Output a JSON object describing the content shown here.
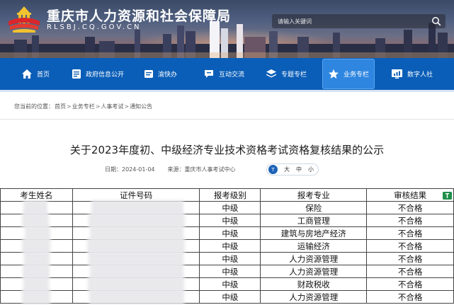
{
  "site": {
    "title": "重庆市人力资源和社会保障局",
    "domain": "RLSBJ.CQ.GOV.CN"
  },
  "search": {
    "placeholder": "请输入关键词"
  },
  "nav": {
    "items": [
      {
        "label": "首页",
        "icon": "home-icon"
      },
      {
        "label": "政府信息公开",
        "icon": "government-info-icon"
      },
      {
        "label": "渝快办",
        "icon": "service-icon"
      },
      {
        "label": "互动交流",
        "icon": "chat-icon"
      },
      {
        "label": "专题专栏",
        "icon": "layers-icon"
      },
      {
        "label": "业务专栏",
        "icon": "star-icon",
        "active": true
      },
      {
        "label": "数字人社",
        "icon": "chart-icon"
      }
    ]
  },
  "breadcrumb": {
    "prefix": "您当前的位置：",
    "items": [
      "首页",
      "业务专栏",
      "人事考试",
      "通知公告"
    ],
    "separator": ">"
  },
  "article": {
    "title": "关于2023年度初、中级经济专业技术资格考试资格复核结果的公示",
    "date_label": "日期：",
    "date": "2024-01-04",
    "source_label": "来源：",
    "source": "重庆市人事考试中心",
    "font_sizes": [
      "大",
      "中",
      "小"
    ]
  },
  "table": {
    "headers": [
      "考生姓名",
      "证件号码",
      "报考级别",
      "报考专业",
      "审核结果"
    ],
    "rows": [
      {
        "level": "中级",
        "major": "保险",
        "result": "不合格"
      },
      {
        "level": "中级",
        "major": "工商管理",
        "result": "不合格"
      },
      {
        "level": "中级",
        "major": "建筑与房地产经济",
        "result": "不合格"
      },
      {
        "level": "中级",
        "major": "运输经济",
        "result": "不合格"
      },
      {
        "level": "中级",
        "major": "人力资源管理",
        "result": "不合格"
      },
      {
        "level": "中级",
        "major": "人力资源管理",
        "result": "不合格"
      },
      {
        "level": "中级",
        "major": "财政税收",
        "result": "不合格"
      },
      {
        "level": "中级",
        "major": "人力资源管理",
        "result": "不合格"
      }
    ]
  },
  "colors": {
    "nav_bg": "#0a5eb8",
    "nav_active": "#2f86e0",
    "accent_dark": "#1d63b8"
  }
}
